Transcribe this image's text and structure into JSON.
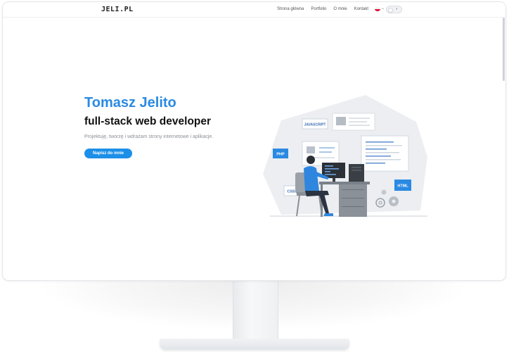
{
  "logo": "JELI.PL",
  "nav": {
    "items": [
      {
        "label": "Strona główna"
      },
      {
        "label": "Portfolio"
      },
      {
        "label": "O mnie"
      },
      {
        "label": "Kontakt"
      }
    ]
  },
  "hero": {
    "title": "Tomasz Jelito",
    "subtitle": "full-stack web developer",
    "description": "Projektuję, tworzę i wdrażam strony internetowe i aplikacje.",
    "cta_label": "Napisz do mnie"
  },
  "illustration": {
    "tags": {
      "javascript": "JAVASCRIPT",
      "php": "PHP",
      "css": "CSS",
      "html": "HTML"
    }
  },
  "colors": {
    "accent": "#2a8ae2",
    "button": "#1c8fe8"
  }
}
